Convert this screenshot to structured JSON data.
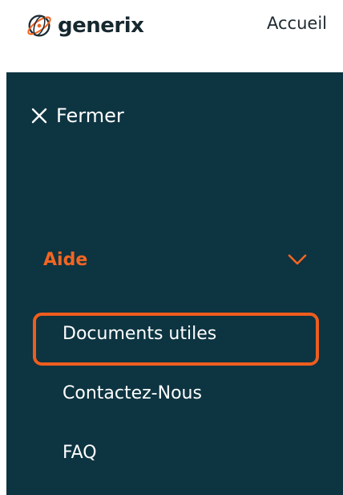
{
  "header": {
    "logo_text": "generix",
    "home_link": "Accueil"
  },
  "menu": {
    "close_label": "Fermer",
    "section": {
      "label": "Aide",
      "items": [
        {
          "label": "Documents utiles"
        },
        {
          "label": "Contactez-Nous"
        },
        {
          "label": "FAQ"
        }
      ]
    }
  },
  "colors": {
    "panel_background": "#0d3441",
    "accent": "#f26522",
    "highlight_border": "#ef5d1e",
    "logo_text": "#17282f",
    "menu_text": "#ffffff"
  },
  "icons": {
    "logo": "generix-globe-logo-icon",
    "close": "close-icon",
    "chevron": "chevron-down-icon"
  }
}
